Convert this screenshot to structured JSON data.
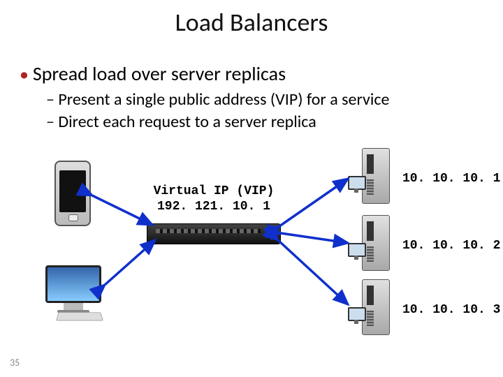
{
  "title": "Load Balancers",
  "bullets": {
    "main": "Spread load over server replicas",
    "sub1": "Present a single public address (VIP) for a service",
    "sub2": "Direct each request to a server replica"
  },
  "diagram": {
    "vip_label": "Virtual IP (VIP)",
    "vip_ip": "192. 121. 10. 1",
    "clients": [
      "smartphone",
      "desktop-computer"
    ],
    "load_balancer": "load-balancer-appliance",
    "servers": [
      {
        "ip": "10. 10. 10. 1"
      },
      {
        "ip": "10. 10. 10. 2"
      },
      {
        "ip": "10. 10. 10. 3"
      }
    ]
  },
  "page_number": "35"
}
